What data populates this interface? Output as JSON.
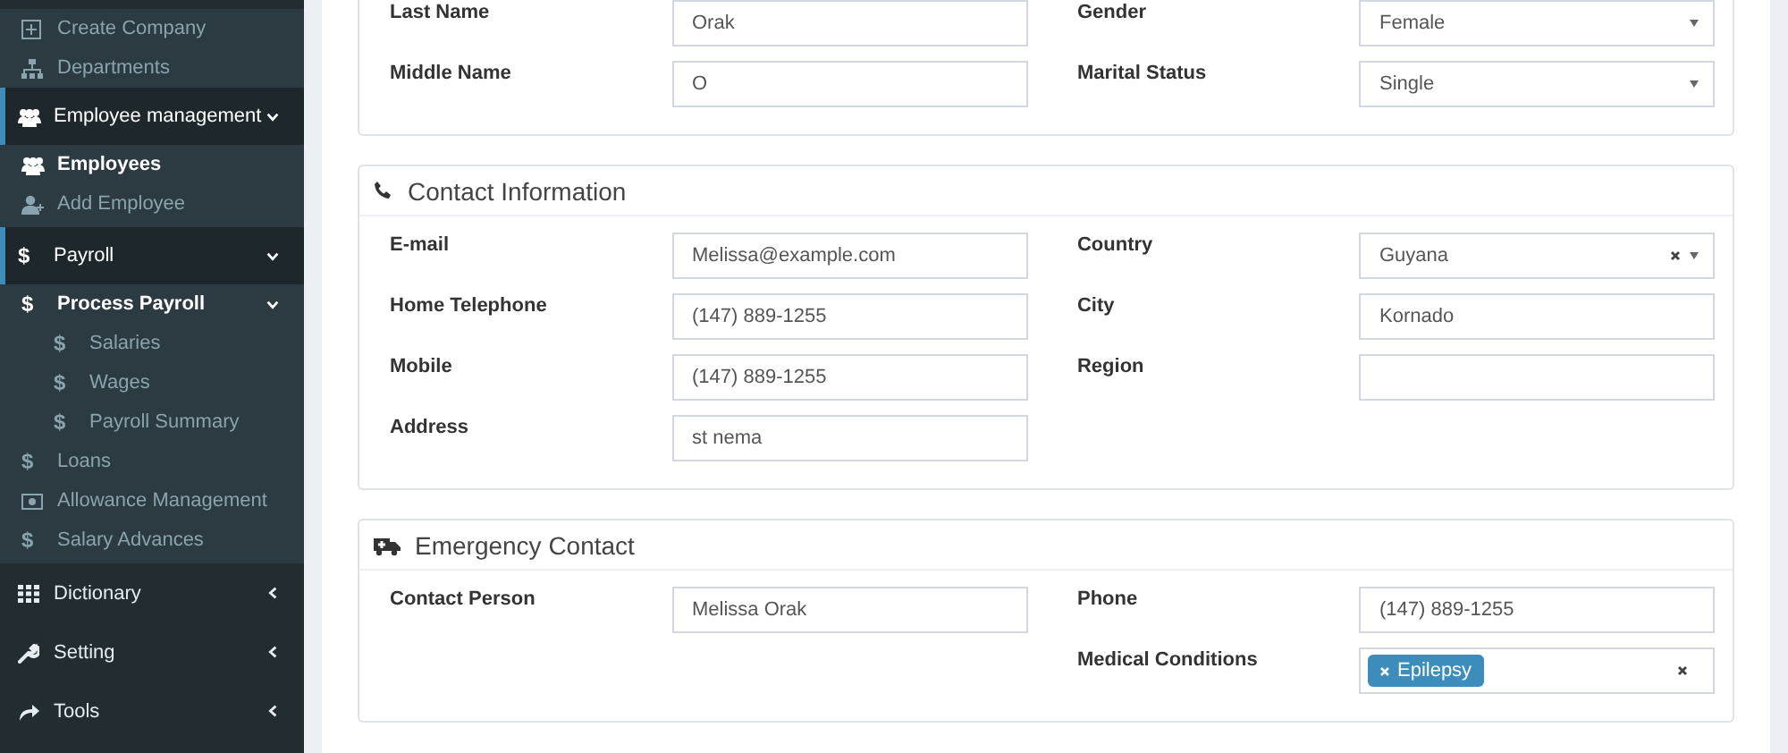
{
  "sidebar": {
    "items": [
      {
        "kind": "sub",
        "label": "Create Company",
        "selected": false
      },
      {
        "kind": "sub",
        "label": "Departments",
        "selected": false
      },
      {
        "kind": "menu",
        "label": "Employee management",
        "expanded": true,
        "children": [
          {
            "label": "Employees",
            "selected": true
          },
          {
            "label": "Add Employee",
            "selected": false
          }
        ]
      },
      {
        "kind": "menu",
        "icon": "$",
        "label": "Payroll",
        "expanded": true,
        "children": [
          {
            "icon": "$",
            "label": "Process Payroll",
            "selected": true,
            "expanded": true,
            "children": [
              {
                "icon": "$",
                "label": "Salaries",
                "selected": false
              },
              {
                "icon": "$",
                "label": "Wages",
                "selected": false
              },
              {
                "icon": "$",
                "label": "Payroll Summary",
                "selected": false
              }
            ]
          },
          {
            "icon": "$",
            "label": "Loans",
            "selected": false
          },
          {
            "label": "Allowance Management",
            "selected": false
          },
          {
            "icon": "$",
            "label": "Salary Advances",
            "selected": false
          }
        ]
      },
      {
        "kind": "menu",
        "label": "Dictionary",
        "expanded": false
      },
      {
        "kind": "menu",
        "label": "Setting",
        "expanded": false
      },
      {
        "kind": "menu",
        "label": "Tools",
        "expanded": false
      }
    ]
  },
  "panels": [
    {
      "left": [
        {
          "kind": "text",
          "label": "Last Name",
          "value": "Orak"
        },
        {
          "kind": "text",
          "label": "Middle Name",
          "value": "O"
        }
      ],
      "right": [
        {
          "kind": "select",
          "label": "Gender",
          "value": "Female"
        },
        {
          "kind": "select",
          "label": "Marital Status",
          "value": "Single"
        }
      ]
    },
    {
      "title": "Contact Information",
      "left": [
        {
          "kind": "text",
          "label": "E-mail",
          "value": "Melissa@example.com"
        },
        {
          "kind": "text",
          "label": "Home Telephone",
          "value": "(147) 889-1255"
        },
        {
          "kind": "text",
          "label": "Mobile",
          "value": "(147) 889-1255"
        },
        {
          "kind": "text",
          "label": "Address",
          "value": "st nema"
        }
      ],
      "right": [
        {
          "kind": "combo",
          "label": "Country",
          "value": "Guyana"
        },
        {
          "kind": "text",
          "label": "City",
          "value": "Kornado"
        },
        {
          "kind": "text",
          "label": "Region"
        }
      ]
    },
    {
      "title": "Emergency Contact",
      "left": [
        {
          "kind": "text",
          "label": "Contact Person",
          "value": "Melissa Orak"
        }
      ],
      "right": [
        {
          "kind": "text",
          "label": "Phone",
          "value": "(147) 889-1255"
        },
        {
          "kind": "tags",
          "label": "Medical Conditions",
          "tags": [
            "Epilepsy"
          ]
        }
      ]
    }
  ]
}
